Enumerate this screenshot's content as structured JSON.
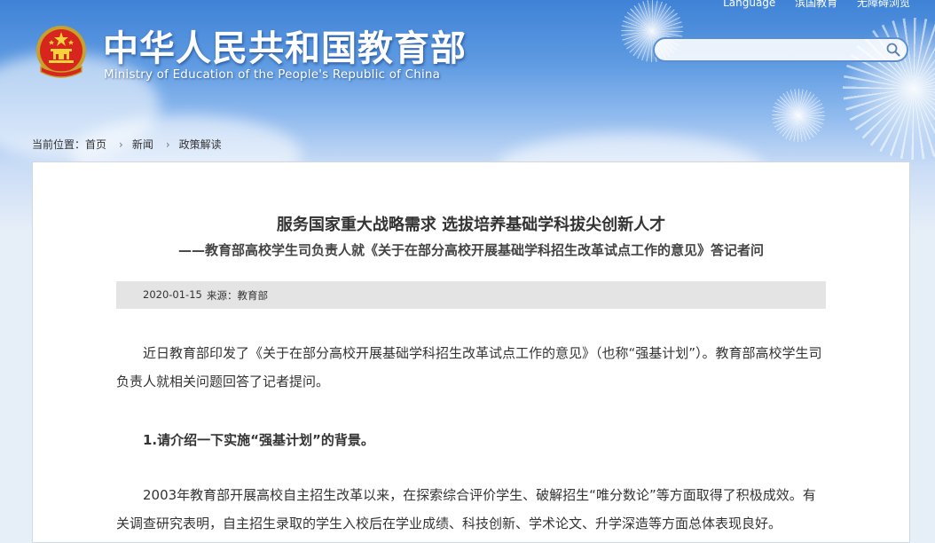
{
  "header": {
    "top_links": [
      "Language",
      "滨国教育",
      "无障碍浏览"
    ],
    "title_cn": "中华人民共和国教育部",
    "title_en": "Ministry of Education of the People's Republic of China"
  },
  "search": {
    "value": "",
    "placeholder": ""
  },
  "breadcrumb": {
    "prefix": "当前位置：",
    "items": [
      "首页",
      "新闻",
      "政策解读"
    ]
  },
  "article": {
    "title": "服务国家重大战略需求 选拔培养基础学科拔尖创新人才",
    "subtitle": "——教育部高校学生司负责人就《关于在部分高校开展基础学科招生改革试点工作的意见》答记者问",
    "date": "2020-01-15",
    "source": "来源：教育部",
    "paragraph1": "近日教育部印发了《关于在部分高校开展基础学科招生改革试点工作的意见》（也称“强基计划”）。教育部高校学生司负责人就相关问题回答了记者提问。",
    "heading1": "1.请介绍一下实施“强基计划”的背景。",
    "paragraph2": "2003年教育部开展高校自主招生改革以来，在探索综合评价学生、破解招生“唯分数论”等方面取得了积极成效。有关调查研究表明，自主招生录取的学生入校后在学业成绩、科技创新、学术论文、升学深造等方面总体表现良好。"
  },
  "colors": {
    "header_blue": "#3f82d6",
    "content_bg": "#ffffff",
    "meta_bar": "#e4e4e4",
    "text": "#333333"
  }
}
